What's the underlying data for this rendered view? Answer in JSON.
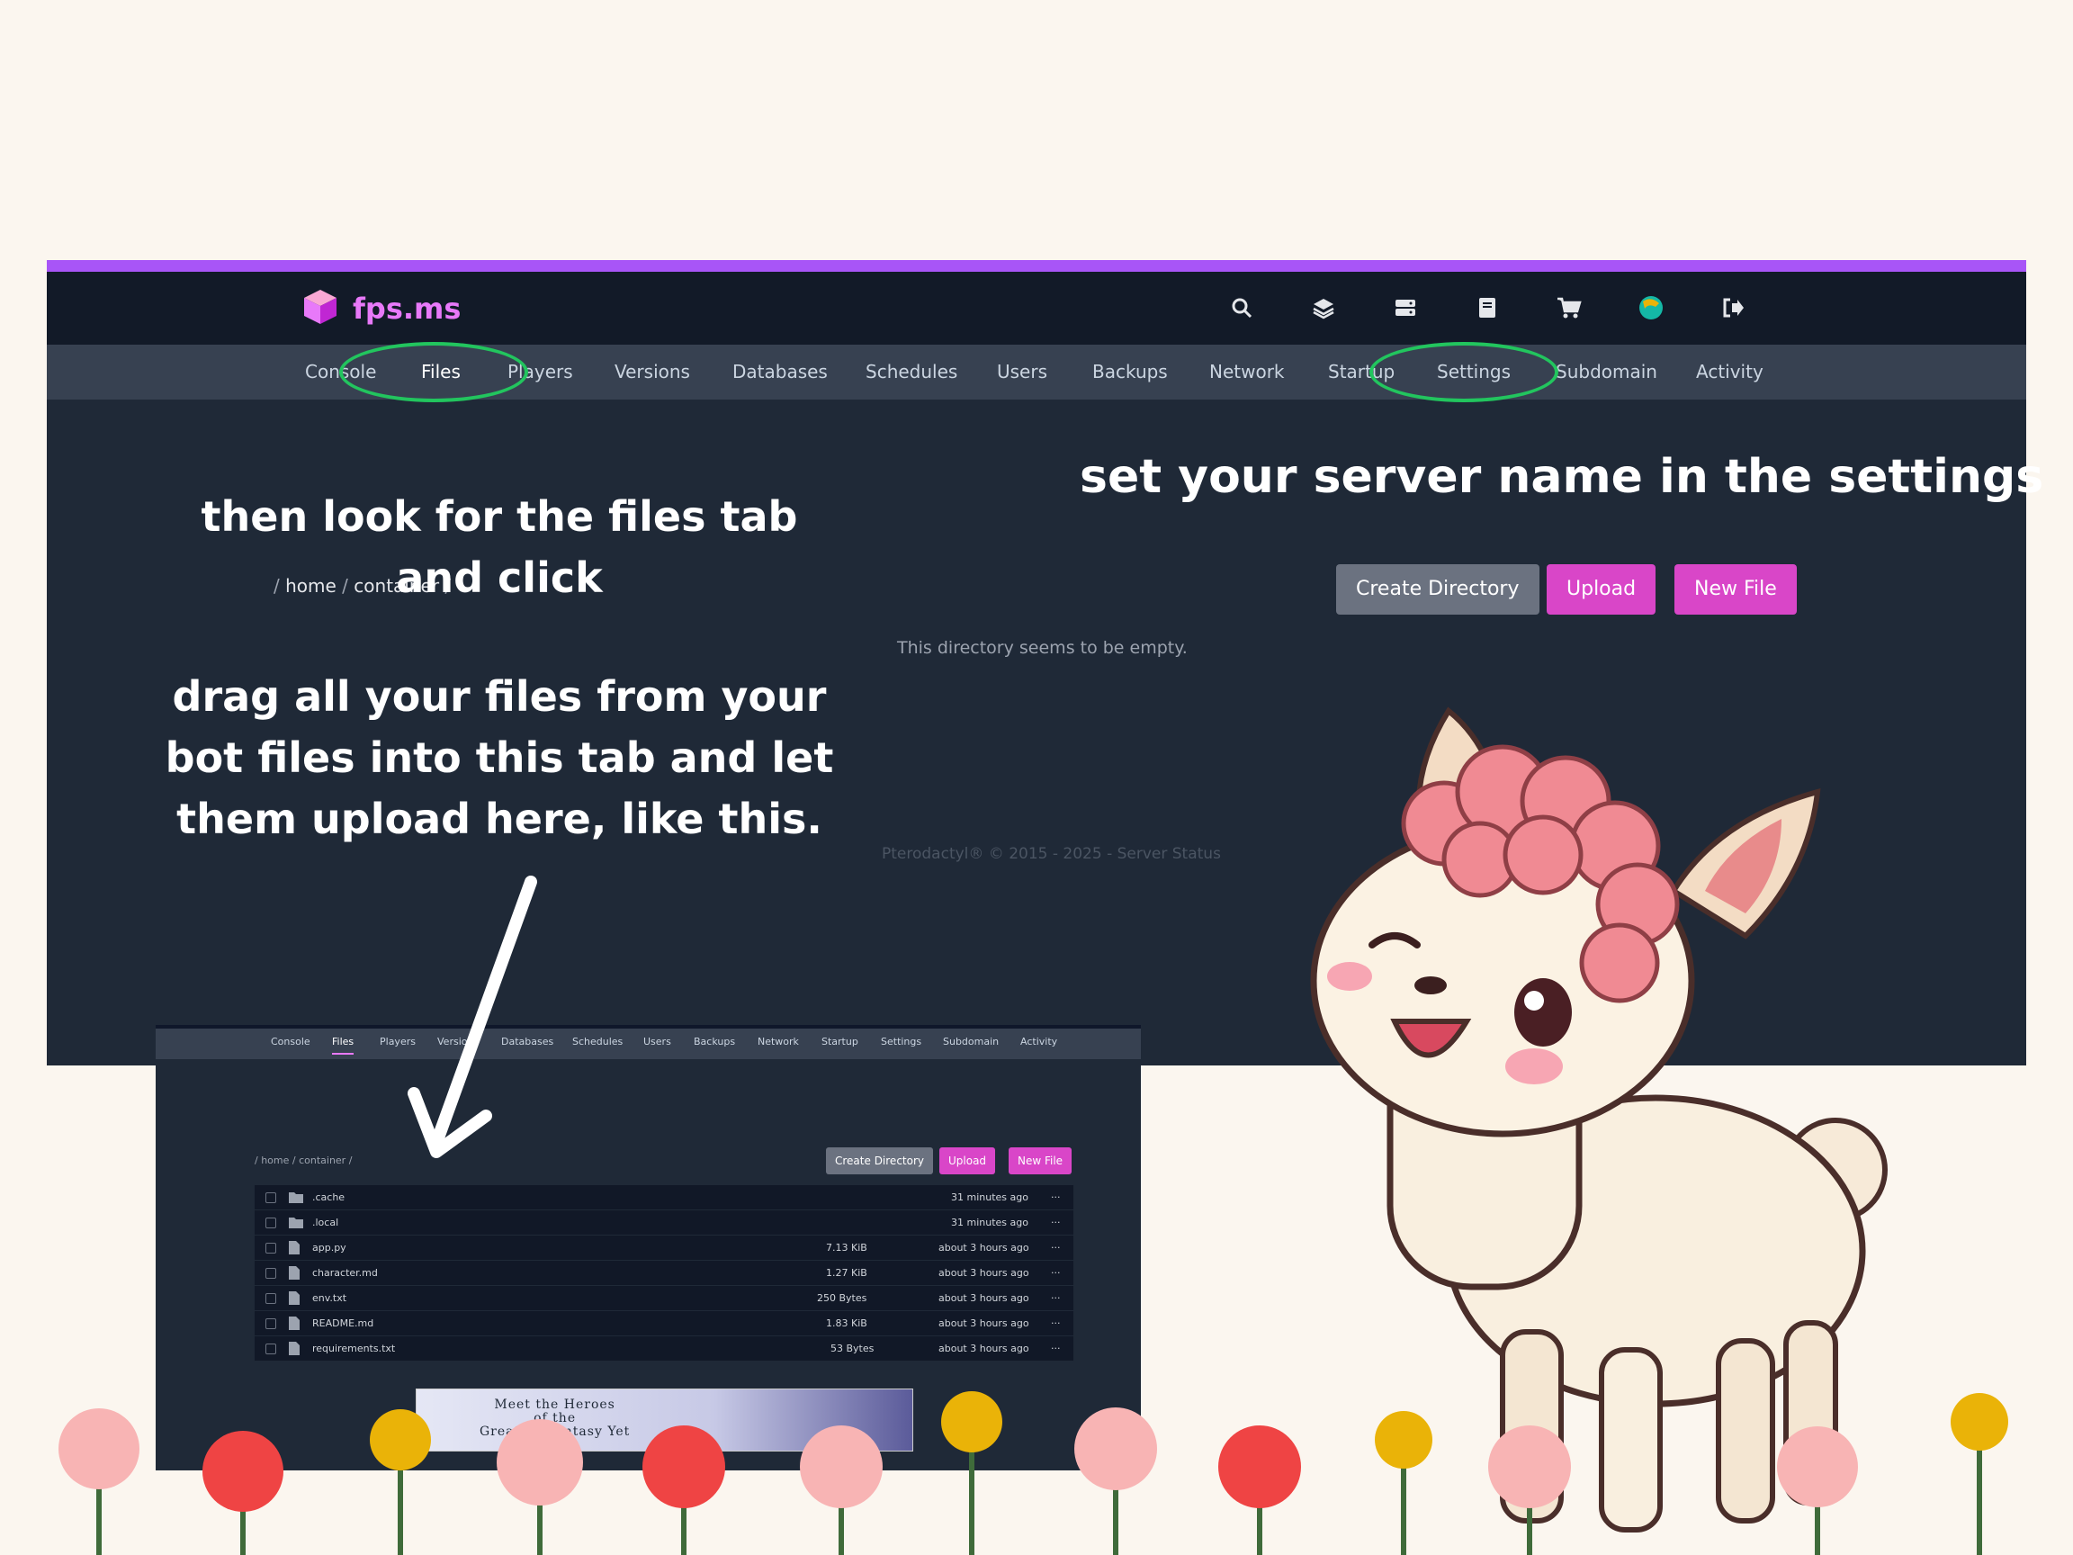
{
  "app": {
    "brand": "fps.ms",
    "top_icons": [
      "search-icon",
      "layers-icon",
      "server-icon",
      "book-icon",
      "cart-icon",
      "avatar-icon",
      "logout-icon"
    ]
  },
  "tabs": [
    "Console",
    "Files",
    "Players",
    "Versions",
    "Databases",
    "Schedules",
    "Users",
    "Backups",
    "Network",
    "Startup",
    "Settings",
    "Subdomain",
    "Activity"
  ],
  "active_tab": "Files",
  "breadcrumb": {
    "sep": "/",
    "home": "home",
    "container": "container"
  },
  "buttons": {
    "create_directory": "Create Directory",
    "upload": "Upload",
    "new_file": "New File"
  },
  "empty_message": "This directory seems to be empty.",
  "footer": "Pterodactyl® © 2015 - 2025 - Server Status",
  "annotations": {
    "files_tab_line1": "then look for the files tab",
    "files_tab_line2": "and click",
    "settings_note": "set your server name in the settings",
    "drag_line1": "drag all your files from your",
    "drag_line2": "bot files into this tab and let",
    "drag_line3": "them upload here, like this."
  },
  "example": {
    "tabs": [
      "Console",
      "Files",
      "Players",
      "Versions",
      "Databases",
      "Schedules",
      "Users",
      "Backups",
      "Network",
      "Startup",
      "Settings",
      "Subdomain",
      "Activity"
    ],
    "breadcrumb": "/ home / container /",
    "buttons": {
      "create_directory": "Create Directory",
      "upload": "Upload",
      "new_file": "New File"
    },
    "files": [
      {
        "name": ".cache",
        "type": "folder",
        "size": "",
        "modified": "31 minutes ago"
      },
      {
        "name": ".local",
        "type": "folder",
        "size": "",
        "modified": "31 minutes ago"
      },
      {
        "name": "app.py",
        "type": "file",
        "size": "7.13 KiB",
        "modified": "about 3 hours ago"
      },
      {
        "name": "character.md",
        "type": "file",
        "size": "1.27 KiB",
        "modified": "about 3 hours ago"
      },
      {
        "name": "env.txt",
        "type": "file",
        "size": "250 Bytes",
        "modified": "about 3 hours ago"
      },
      {
        "name": "README.md",
        "type": "file",
        "size": "1.83 KiB",
        "modified": "about 3 hours ago"
      },
      {
        "name": "requirements.txt",
        "type": "file",
        "size": "53 Bytes",
        "modified": "about 3 hours ago"
      }
    ],
    "ad_text": [
      "Meet the Heroes",
      "of the",
      "Greatest Fantasy Yet"
    ]
  },
  "colors": {
    "accent": "#a855f7",
    "brand": "#e879f9",
    "button_pink": "#d946c8",
    "highlight": "#22c55e"
  }
}
